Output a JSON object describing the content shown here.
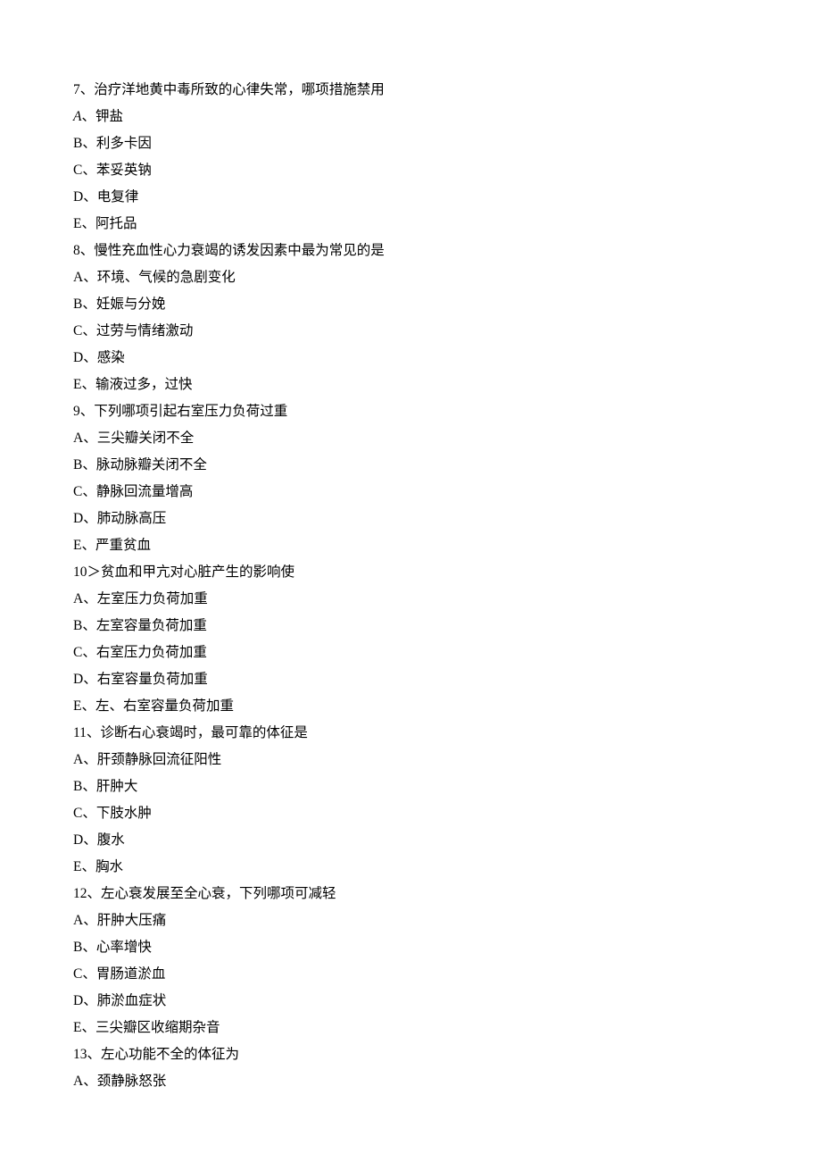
{
  "q7": {
    "stem": "7、治疗洋地黄中毒所致的心律失常，哪项措施禁用",
    "A_prefix": "A",
    "A_sep": "、",
    "A_text": "钾盐",
    "B": "B、利多卡因",
    "C": "C、苯妥英钠",
    "D": "D、电复律",
    "E": "E、阿托品"
  },
  "q8": {
    "stem": "8、慢性充血性心力衰竭的诱发因素中最为常见的是",
    "A": "A、环境、气候的急剧变化",
    "B": "B、妊娠与分娩",
    "C": "C、过劳与情绪激动",
    "D": "D、感染",
    "E": "E、输液过多，过快"
  },
  "q9": {
    "stem": "9、下列哪项引起右室压力负荷过重",
    "A": "A、三尖瓣关闭不全",
    "B": "B、脉动脉瓣关闭不全",
    "C": "C、静脉回流量增高",
    "D": "D、肺动脉高压",
    "E": "E、严重贫血"
  },
  "q10": {
    "stem": "10＞贫血和甲亢对心脏产生的影响使",
    "A": "A、左室压力负荷加重",
    "B": "B、左室容量负荷加重",
    "C": "C、右室压力负荷加重",
    "D": "D、右室容量负荷加重",
    "E": "E、左、右室容量负荷加重"
  },
  "q11": {
    "stem": "11、诊断右心衰竭时，最可靠的体征是",
    "A": "A、肝颈静脉回流征阳性",
    "B": "B、肝肿大",
    "C": "C、下肢水肿",
    "D": "D、腹水",
    "E": "E、胸水"
  },
  "q12": {
    "stem": "12、左心衰发展至全心衰，下列哪项可减轻",
    "A": "A、肝肿大压痛",
    "B": "B、心率增快",
    "C": "C、胃肠道淤血",
    "D": "D、肺淤血症状",
    "E": "E、三尖瓣区收缩期杂音"
  },
  "q13": {
    "stem": "13、左心功能不全的体征为",
    "A": "A、颈静脉怒张"
  }
}
